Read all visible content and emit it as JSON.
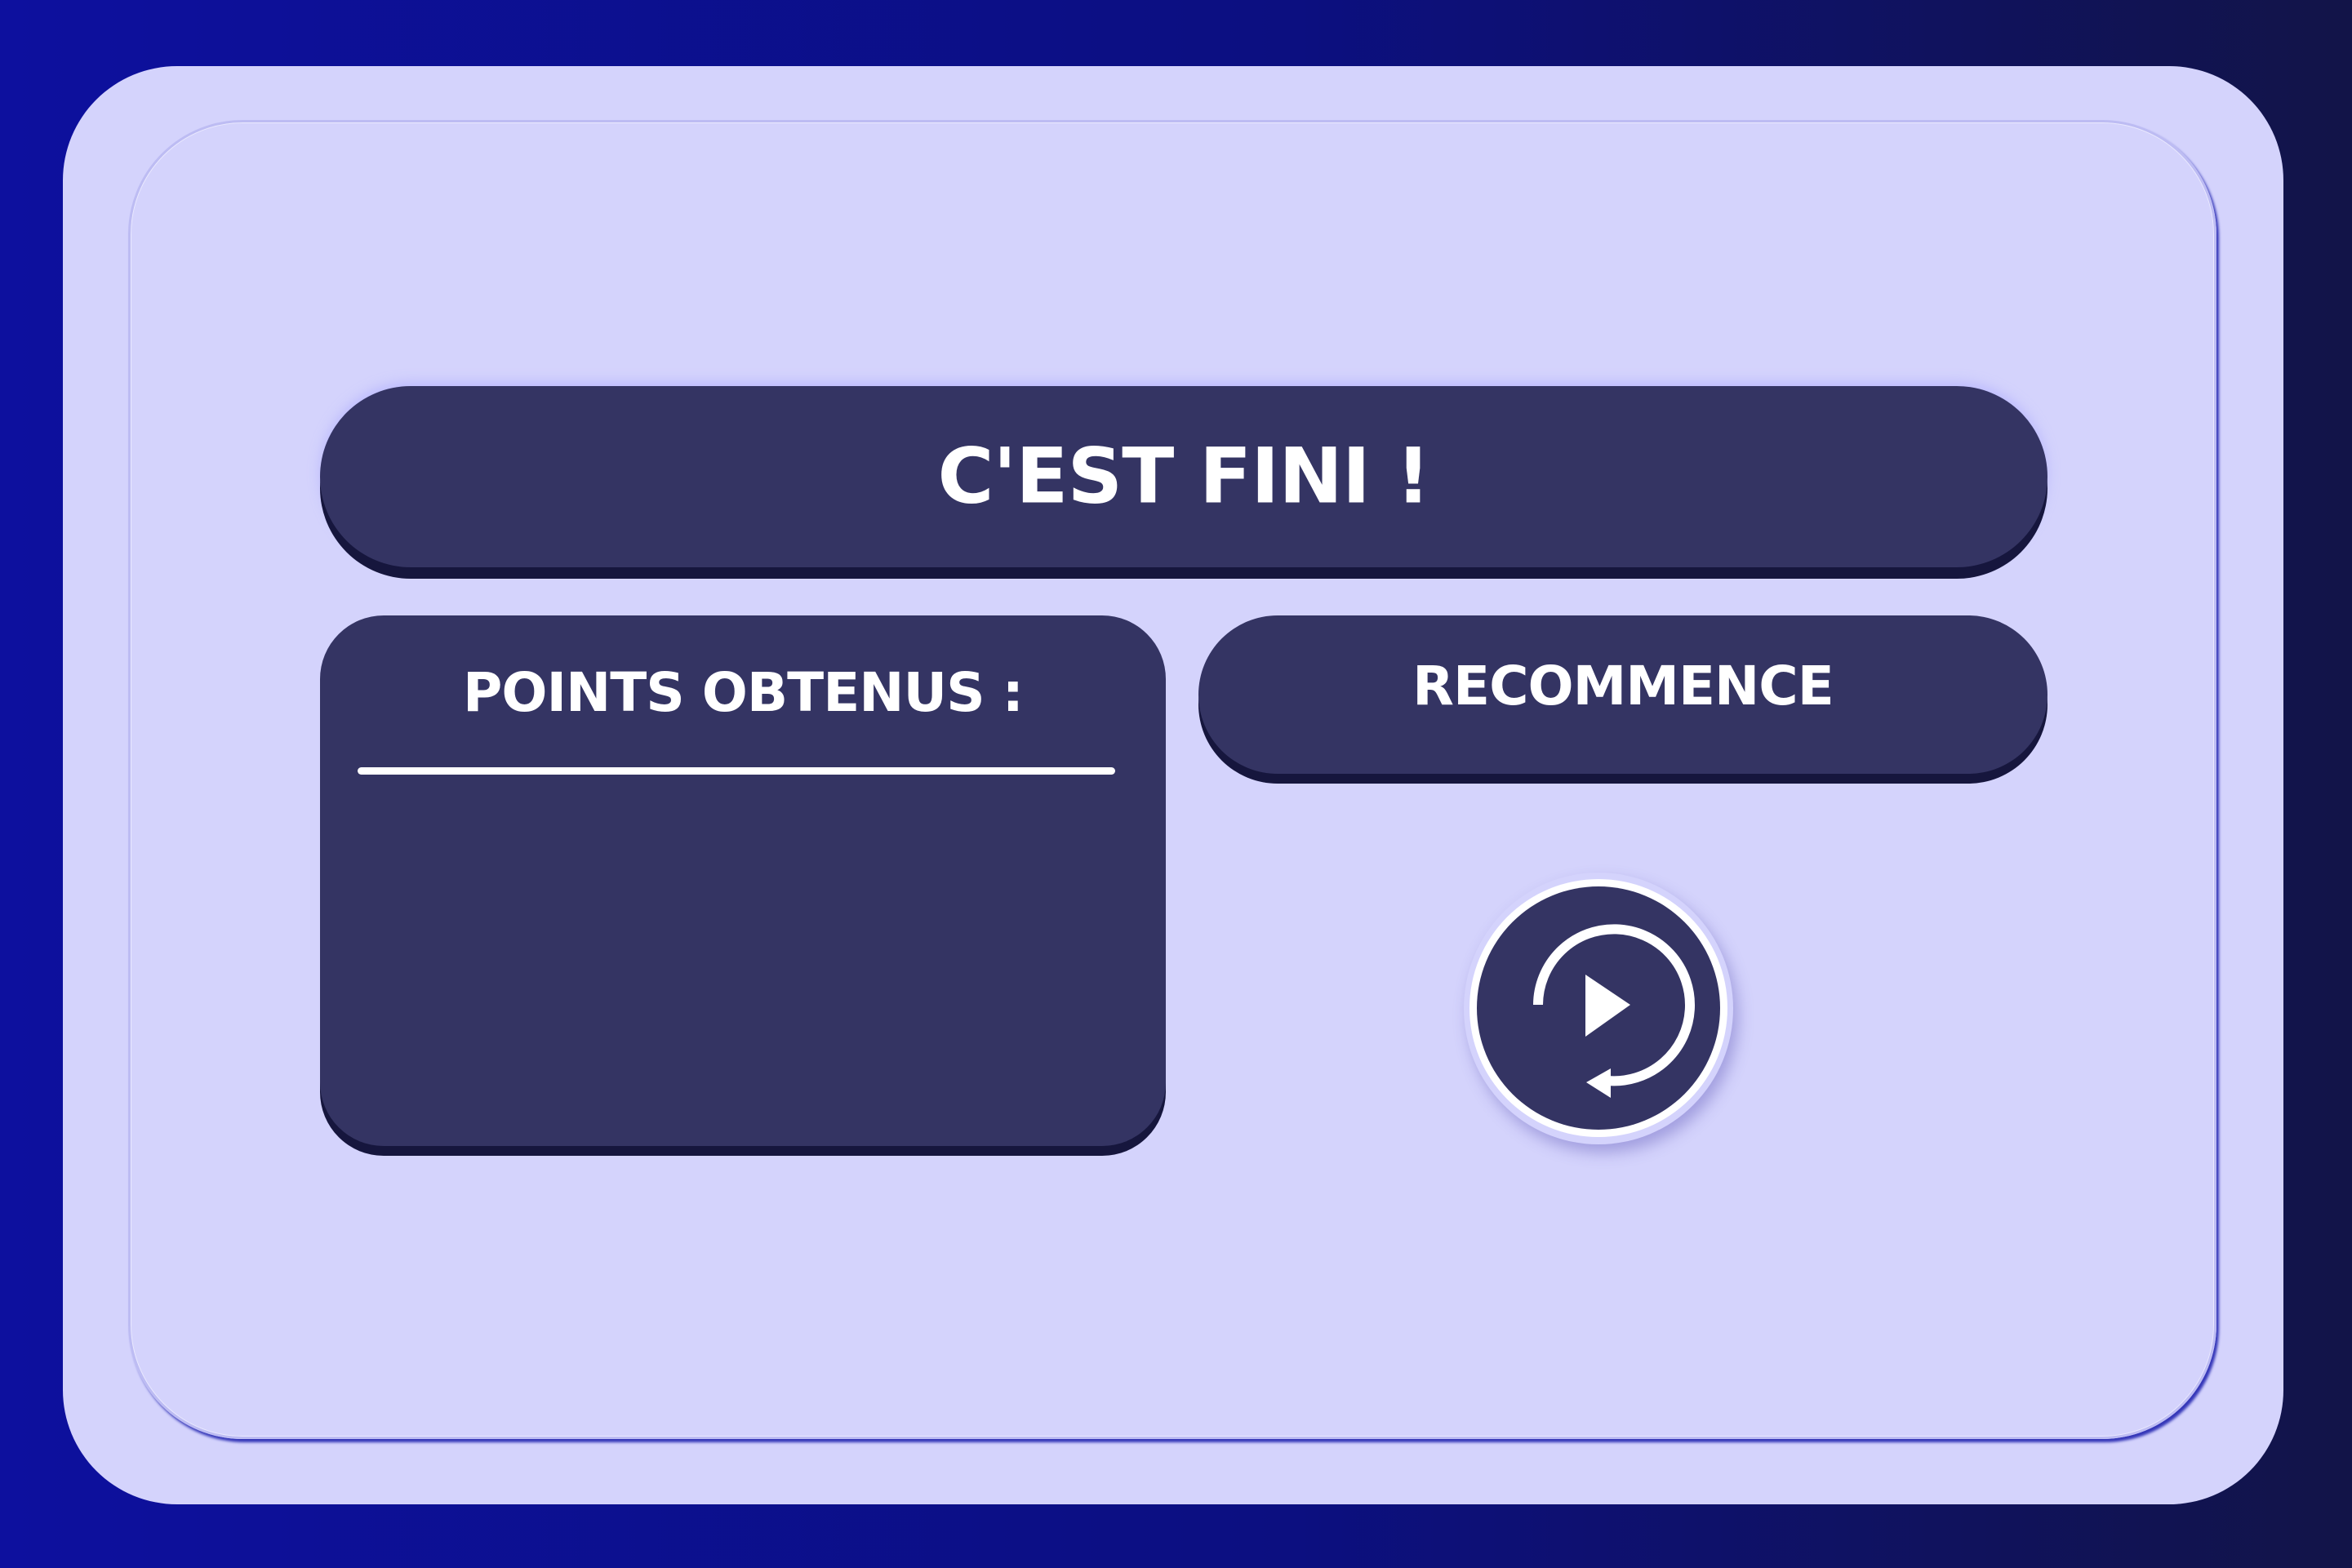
{
  "title": "C'EST FINI !",
  "points": {
    "label": "POINTS OBTENUS :",
    "value": ""
  },
  "restart": {
    "label": "RECOMMENCE",
    "icon": "replay-play-icon"
  },
  "colors": {
    "background_left": "#0d109e",
    "background_right": "#121448",
    "card": "#d4d3fc",
    "panel": "#343463",
    "panel_shadow": "#16163d",
    "text": "#ffffff"
  }
}
